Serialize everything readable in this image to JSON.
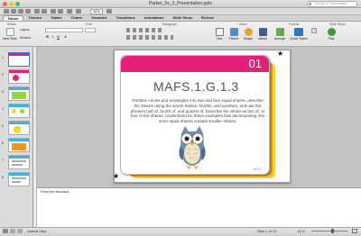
{
  "window": {
    "title": "Parker_6s_3_Presentation.pptx",
    "search_placeholder": "Search in Presentation"
  },
  "tabs": [
    "Home",
    "Themes",
    "Tables",
    "Charts",
    "SmartArt",
    "Transitions",
    "Animations",
    "Slide Show",
    "Review"
  ],
  "active_tab": "Home",
  "ribbon": {
    "groups": [
      "Slides",
      "Font",
      "Paragraph",
      "Insert",
      "Format",
      "Slide Show"
    ],
    "new_slide": "New Slide",
    "layout": "Layout",
    "section": "Section",
    "font_name": "",
    "font_size": "",
    "insert_buttons": [
      "Text",
      "Picture",
      "Shape",
      "Media",
      "Arrange",
      "Quick Styles"
    ],
    "play": "Play",
    "colors": {
      "pink": "#e2217b",
      "blue": "#2e75c8"
    }
  },
  "toolbar": {
    "zoom": "81%"
  },
  "slides": {
    "numbers": [
      "1",
      "2",
      "3",
      "4",
      "5",
      "6",
      "7",
      "8"
    ],
    "selected": 1
  },
  "slide": {
    "number_badge": "01",
    "title": "MAFS.1.G.1.3",
    "body": "Partition circles and rectangles into two and four equal shares, describe the shares using the words halves, fourths, and quarters, and use the phrases half of, fourth of, and quarter of. Describe the whole as two of, or four of the shares. Understand for these examples that decomposing into more equal shares creates smaller shares.",
    "footer": "APG",
    "card_colors": {
      "bar": "#e2217b",
      "stack": [
        "#9bd240",
        "#3db3e5",
        "#f7941d",
        "#f6d42b"
      ]
    }
  },
  "notes": {
    "text": "Read the standard"
  },
  "status": {
    "view": "Normal View",
    "slide_info": "Slide 1 of 13",
    "zoom": "81%"
  }
}
